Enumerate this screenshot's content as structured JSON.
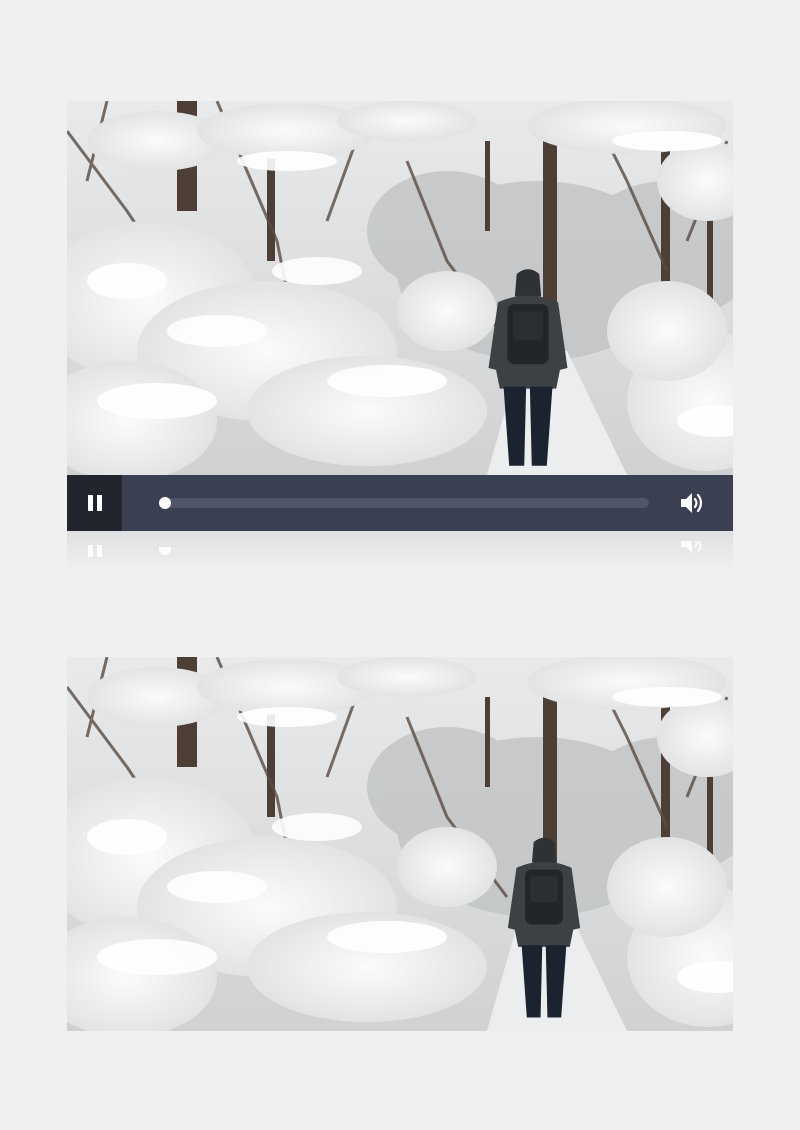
{
  "player": {
    "state": "playing",
    "progress": 0.0,
    "play_pause_icon": "pause-icon",
    "volume_icon": "volume-icon",
    "colors": {
      "control_bar": "#3b3f52",
      "play_button_bg": "#23252e",
      "track": "#50556a",
      "thumb": "#ffffff",
      "page_background": "#f0f0f0"
    }
  },
  "frames": [
    {
      "scene": "snowy-forest-hiker"
    },
    {
      "scene": "snowy-forest-hiker"
    }
  ]
}
